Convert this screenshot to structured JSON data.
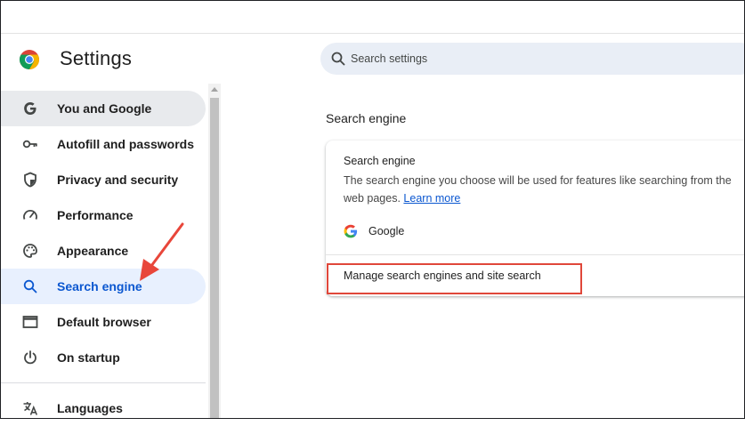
{
  "app": {
    "title": "Settings"
  },
  "search": {
    "placeholder": "Search settings"
  },
  "sidebar": {
    "items": [
      {
        "label": "You and Google",
        "icon": "google-g-icon",
        "state": "hovered"
      },
      {
        "label": "Autofill and passwords",
        "icon": "key-icon",
        "state": ""
      },
      {
        "label": "Privacy and security",
        "icon": "shield-icon",
        "state": ""
      },
      {
        "label": "Performance",
        "icon": "speedometer-icon",
        "state": ""
      },
      {
        "label": "Appearance",
        "icon": "palette-icon",
        "state": ""
      },
      {
        "label": "Search engine",
        "icon": "search-icon",
        "state": "active"
      },
      {
        "label": "Default browser",
        "icon": "browser-window-icon",
        "state": ""
      },
      {
        "label": "On startup",
        "icon": "power-icon",
        "state": ""
      },
      {
        "label": "Languages",
        "icon": "translate-icon",
        "state": ""
      }
    ]
  },
  "main": {
    "section_title": "Search engine",
    "card": {
      "title": "Search engine",
      "description_line1": "The search engine you choose will be used for features like searching from the",
      "description_line2": "web pages.",
      "learn_more": "Learn more",
      "engine_name": "Google",
      "manage_label": "Manage search engines and site search"
    }
  },
  "colors": {
    "accent": "#0b57d0",
    "active_bg": "#e8f0fe",
    "hover_bg": "#e8eaed",
    "annotation": "#e0473a"
  }
}
